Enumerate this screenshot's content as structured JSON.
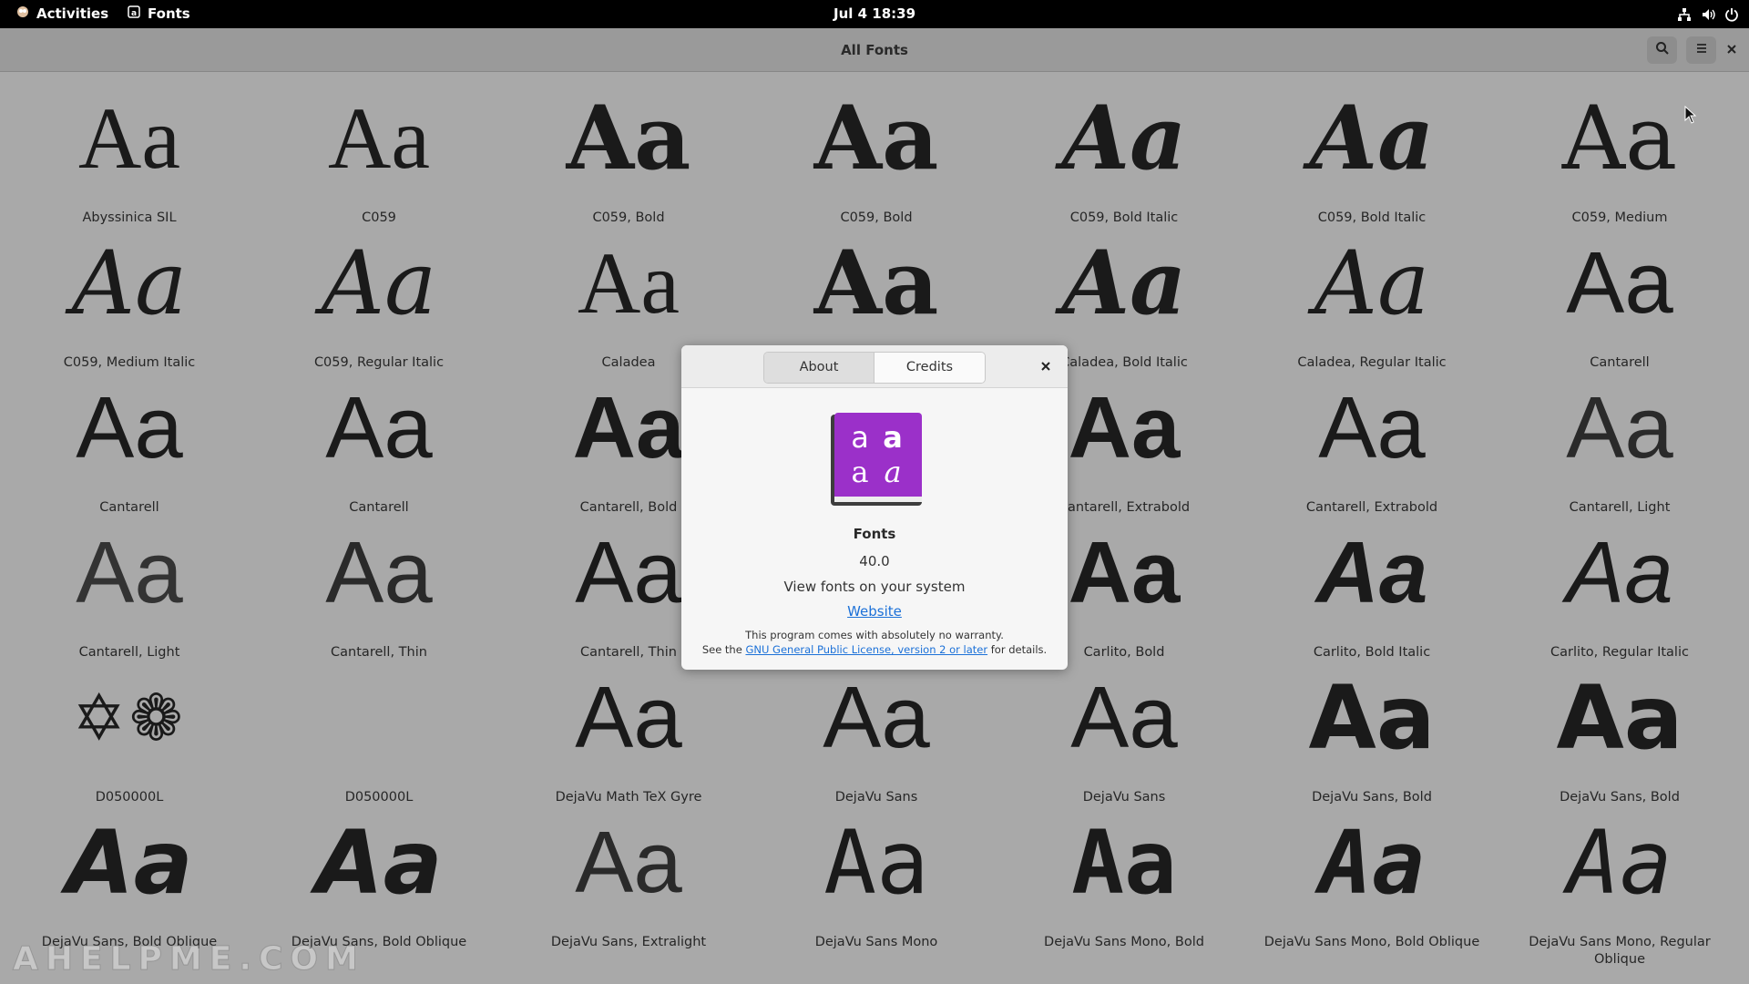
{
  "topbar": {
    "activities": "Activities",
    "app_menu": "Fonts",
    "clock": "Jul 4  18:39",
    "tray_icons": [
      "network-icon",
      "volume-icon",
      "power-icon"
    ]
  },
  "window": {
    "title": "All Fonts",
    "buttons": [
      "search-icon",
      "hamburger-menu-icon",
      "close-icon"
    ]
  },
  "fonts": [
    {
      "name": "Abyssinica SIL",
      "sample": "Aa"
    },
    {
      "name": "C059",
      "sample": "Aa"
    },
    {
      "name": "C059, Bold",
      "sample": "Aa"
    },
    {
      "name": "C059, Bold",
      "sample": "Aa"
    },
    {
      "name": "C059, Bold Italic",
      "sample": "Aa"
    },
    {
      "name": "C059, Bold Italic",
      "sample": "Aa"
    },
    {
      "name": "C059, Medium",
      "sample": "Aa"
    },
    {
      "name": "C059, Medium Italic",
      "sample": "Aa"
    },
    {
      "name": "C059, Regular Italic",
      "sample": "Aa"
    },
    {
      "name": "Caladea",
      "sample": "Aa"
    },
    {
      "name": "",
      "sample": "Aa"
    },
    {
      "name": "Caladea, Bold Italic",
      "sample": "Aa"
    },
    {
      "name": "Caladea, Regular Italic",
      "sample": "Aa"
    },
    {
      "name": "Cantarell",
      "sample": "Aa"
    },
    {
      "name": "Cantarell",
      "sample": "Aa"
    },
    {
      "name": "Cantarell",
      "sample": "Aa"
    },
    {
      "name": "Cantarell, Bold",
      "sample": "Aa"
    },
    {
      "name": "",
      "sample": ""
    },
    {
      "name": "Cantarell, Extrabold",
      "sample": "Aa"
    },
    {
      "name": "Cantarell, Extrabold",
      "sample": "Aa"
    },
    {
      "name": "Cantarell, Light",
      "sample": "Aa"
    },
    {
      "name": "Cantarell, Light",
      "sample": "Aa"
    },
    {
      "name": "Cantarell, Thin",
      "sample": "Aa"
    },
    {
      "name": "Cantarell, Thin",
      "sample": "Aa"
    },
    {
      "name": "",
      "sample": ""
    },
    {
      "name": "Carlito, Bold",
      "sample": "Aa"
    },
    {
      "name": "Carlito, Bold Italic",
      "sample": "Aa"
    },
    {
      "name": "Carlito, Regular Italic",
      "sample": "Aa"
    },
    {
      "name": "D050000L",
      "sample": "✡❁"
    },
    {
      "name": "D050000L",
      "sample": ""
    },
    {
      "name": "DejaVu Math TeX Gyre",
      "sample": "Aa"
    },
    {
      "name": "DejaVu Sans",
      "sample": "Aa"
    },
    {
      "name": "DejaVu Sans",
      "sample": "Aa"
    },
    {
      "name": "DejaVu Sans, Bold",
      "sample": "Aa"
    },
    {
      "name": "DejaVu Sans, Bold",
      "sample": "Aa"
    },
    {
      "name": "DejaVu Sans, Bold Oblique",
      "sample": "Aa"
    },
    {
      "name": "DejaVu Sans, Bold Oblique",
      "sample": "Aa"
    },
    {
      "name": "DejaVu Sans, Extralight",
      "sample": "Aa"
    },
    {
      "name": "DejaVu Sans Mono",
      "sample": "Aa"
    },
    {
      "name": "DejaVu Sans Mono, Bold",
      "sample": "Aa"
    },
    {
      "name": "DejaVu Sans Mono, Bold Oblique",
      "sample": "Aa"
    },
    {
      "name": "DejaVu Sans Mono, Regular Oblique",
      "sample": "Aa"
    }
  ],
  "dialog": {
    "tabs": [
      "About",
      "Credits"
    ],
    "active_tab": "About",
    "app_name": "Fonts",
    "version": "40.0",
    "comment": "View fonts on your system",
    "website_label": "Website",
    "license_line1": "This program comes with absolutely no warranty.",
    "license_prefix": "See the ",
    "license_link": "GNU General Public License, version 2 or later",
    "license_suffix": " for details.",
    "icon_letters": [
      "a",
      "a",
      "a",
      "a"
    ],
    "icon_color": "#9b30c9"
  },
  "watermark": "AHELPME.COM"
}
